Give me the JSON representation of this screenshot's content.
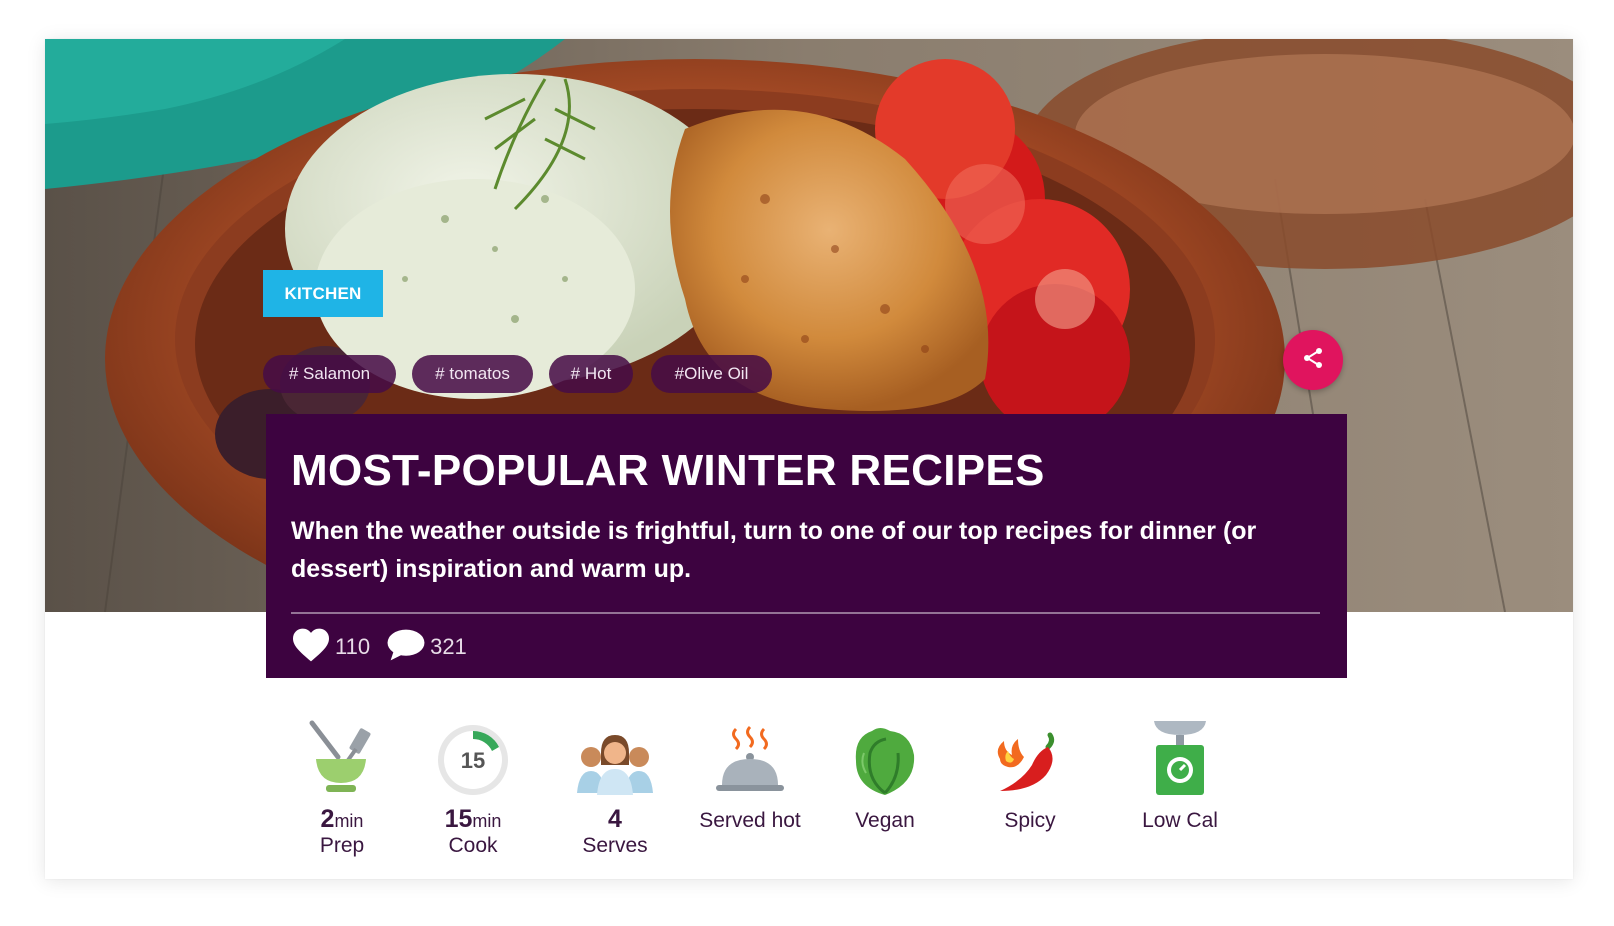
{
  "hero": {
    "category": "KITCHEN",
    "hashtags": [
      "# Salamon",
      "# tomatos",
      "# Hot",
      "#Olive Oil"
    ]
  },
  "share": {
    "icon": "share-icon",
    "color": "#e0145e"
  },
  "article": {
    "title": "MOST-POPULAR WINTER RECIPES",
    "subtitle": "When the weather outside is frightful, turn to one of our top recipes for dinner (or dessert) inspiration and warm up.",
    "likes": "110",
    "comments": "321",
    "panel_color": "#3d0340"
  },
  "features": {
    "prep": {
      "num": "2",
      "unit": "min",
      "label": "Prep",
      "icon": "mortar-pestle-icon"
    },
    "cook": {
      "num": "15",
      "unit": "min",
      "label": "Cook",
      "icon": "timer-icon",
      "timer_text": "15"
    },
    "serves": {
      "num": "4",
      "label": "Serves",
      "icon": "people-icon"
    },
    "served_hot": {
      "label": "Served hot",
      "icon": "cloche-icon"
    },
    "vegan": {
      "label": "Vegan",
      "icon": "lettuce-icon"
    },
    "spicy": {
      "label": "Spicy",
      "icon": "chili-pepper-icon"
    },
    "low_cal": {
      "label": "Low Cal",
      "icon": "scale-icon"
    }
  }
}
